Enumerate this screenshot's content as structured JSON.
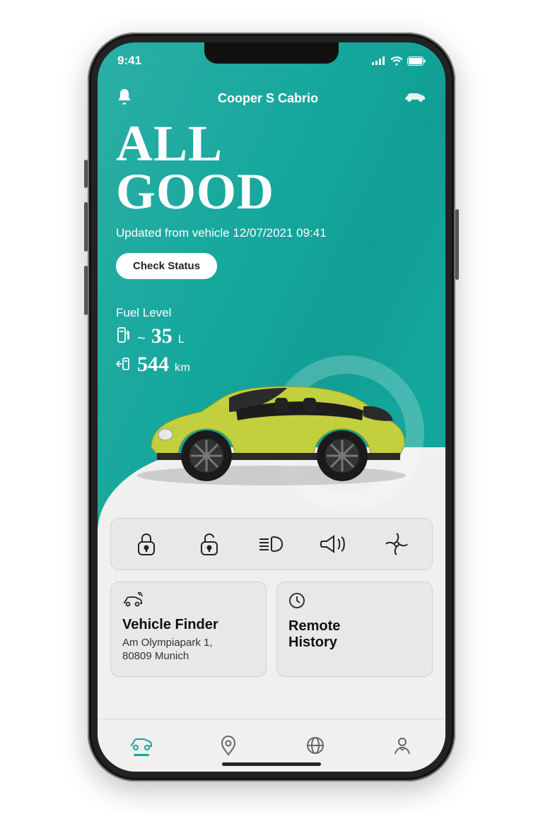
{
  "statusbar": {
    "time": "9:41"
  },
  "header": {
    "title": "Cooper S Cabrio",
    "bell_icon": "bell-icon",
    "car_icon": "car-select-icon"
  },
  "hero": {
    "headline_line1": "ALL",
    "headline_line2": "GOOD",
    "updated_text": "Updated from vehicle 12/07/2021 09:41",
    "check_button": "Check Status"
  },
  "fuel": {
    "label": "Fuel Level",
    "approx": "~",
    "amount": "35",
    "amount_unit": "L",
    "range": "544",
    "range_unit": "km"
  },
  "actions": {
    "items": [
      {
        "name": "lock-icon"
      },
      {
        "name": "unlock-icon"
      },
      {
        "name": "headlights-icon"
      },
      {
        "name": "horn-icon"
      },
      {
        "name": "climate-icon"
      }
    ]
  },
  "cards": {
    "finder": {
      "title": "Vehicle Finder",
      "address_line1": "Am Olympiapark 1,",
      "address_line2": "80809 Munich"
    },
    "history": {
      "title_line1": "Remote",
      "title_line2": "History"
    }
  },
  "nav": {
    "items": [
      {
        "name": "nav-vehicle",
        "active": true
      },
      {
        "name": "nav-map"
      },
      {
        "name": "nav-discover"
      },
      {
        "name": "nav-profile"
      }
    ]
  },
  "colors": {
    "accent": "#13a69c",
    "car_body": "#c2cf3f"
  }
}
